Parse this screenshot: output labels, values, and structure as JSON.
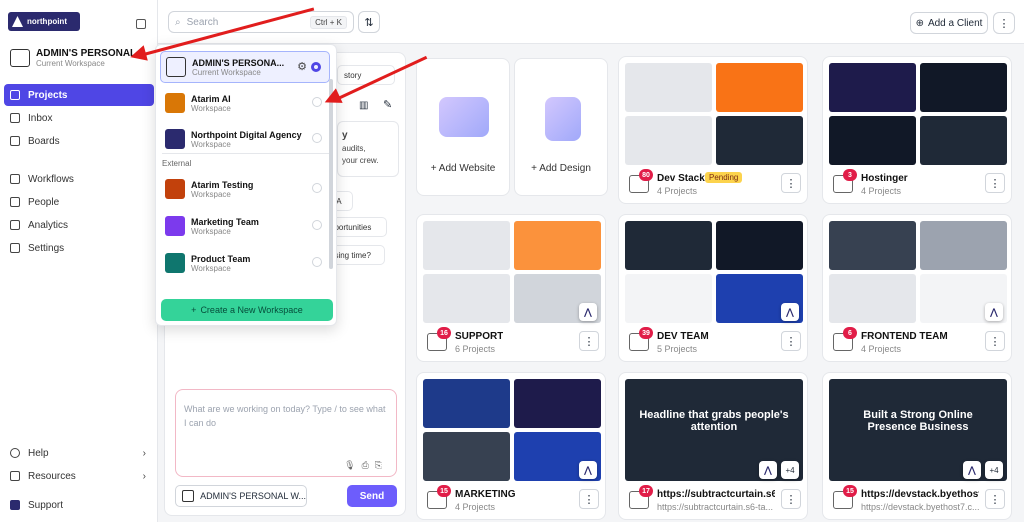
{
  "sidebar": {
    "logo_text": "northpoint",
    "workspace": {
      "name": "ADMIN'S PERSONAL ...",
      "sub": "Current Workspace"
    },
    "nav": [
      {
        "label": "Projects",
        "icon": "grid-icon",
        "active": true
      },
      {
        "label": "Inbox",
        "icon": "inbox-icon"
      },
      {
        "label": "Boards",
        "icon": "board-icon"
      },
      {
        "label": "Workflows",
        "icon": "workflow-icon"
      },
      {
        "label": "People",
        "icon": "people-icon"
      },
      {
        "label": "Analytics",
        "icon": "analytics-icon"
      },
      {
        "label": "Settings",
        "icon": "gear-icon"
      }
    ],
    "bottom": [
      {
        "label": "Help",
        "icon": "help-icon"
      },
      {
        "label": "Resources",
        "icon": "resources-icon"
      },
      {
        "label": "Support",
        "icon": "support-icon"
      }
    ]
  },
  "topbar": {
    "search_placeholder": "Search",
    "search_shortcut": "Ctrl + K",
    "add_client": "Add a Client"
  },
  "dropdown": {
    "items": [
      {
        "name": "ADMIN'S PERSONA...",
        "sub": "Current Workspace",
        "color": "#4b4b6b",
        "current": true
      },
      {
        "name": "Atarim AI",
        "sub": "Workspace",
        "color": "#d97706"
      },
      {
        "name": "Northpoint Digital Agency",
        "sub": "Workspace",
        "color": "#2b2a6e"
      }
    ],
    "section_external": "External",
    "external_items": [
      {
        "name": "Atarim Testing",
        "sub": "Workspace",
        "color": "#c2410c"
      },
      {
        "name": "Marketing Team",
        "sub": "Workspace",
        "color": "#7c3aed"
      },
      {
        "name": "Product Team",
        "sub": "Workspace",
        "color": "#0f766e"
      }
    ],
    "create_label": "Create a New Workspace"
  },
  "chat": {
    "partial_history": "story",
    "partial_title": "y",
    "partial_line1": "audits,",
    "partial_line2": "your crew.",
    "chip_qa": "QA",
    "chip_opps": "pportunities",
    "chip_time": "osing time?",
    "placeholder": "What are we working on today? Type / to see what I can do",
    "workspace_pill": "ADMIN'S PERSONAL W...",
    "send": "Send"
  },
  "add_cards": [
    {
      "label": "Add Website"
    },
    {
      "label": "Add Design"
    }
  ],
  "cards": [
    {
      "name": "Dev Stack",
      "sub": "4 Projects",
      "badge": "80",
      "pending": "Pending",
      "colors": [
        "#e5e7eb",
        "#f97316",
        "#e5e7eb",
        "#1f2937"
      ]
    },
    {
      "name": "Hostinger",
      "sub": "4 Projects",
      "badge": "3",
      "colors": [
        "#1e1b4b",
        "#111827",
        "#111827",
        "#1f2937"
      ]
    },
    {
      "name": "SUPPORT",
      "sub": "6 Projects",
      "badge": "16",
      "colors": [
        "#e5e7eb",
        "#fb923c",
        "#e5e7eb",
        "#d1d5db"
      ]
    },
    {
      "name": "DEV TEAM",
      "sub": "5 Projects",
      "badge": "39",
      "colors": [
        "#1f2937",
        "#111827",
        "#f3f4f6",
        "#1e40af"
      ]
    },
    {
      "name": "FRONTEND TEAM",
      "sub": "4 Projects",
      "badge": "6",
      "colors": [
        "#374151",
        "#9ca3af",
        "#e5e7eb",
        "#f3f4f6"
      ]
    },
    {
      "name": "MARKETING",
      "sub": "4 Projects",
      "badge": "15",
      "colors": [
        "#1e3a8a",
        "#1e1b4b",
        "#374151",
        "#1e40af"
      ]
    },
    {
      "name": "https://subtractcurtain.s6-ta...",
      "sub": "https://subtractcurtain.s6-ta...",
      "badge": "17",
      "plus": "+4",
      "headline": "Headline that grabs people's attention"
    },
    {
      "name": "https://devstack.byethost7.c...",
      "sub": "https://devstack.byethost7.c...",
      "badge": "15",
      "plus": "+4",
      "headline": "Built a Strong Online Presence Business"
    }
  ]
}
